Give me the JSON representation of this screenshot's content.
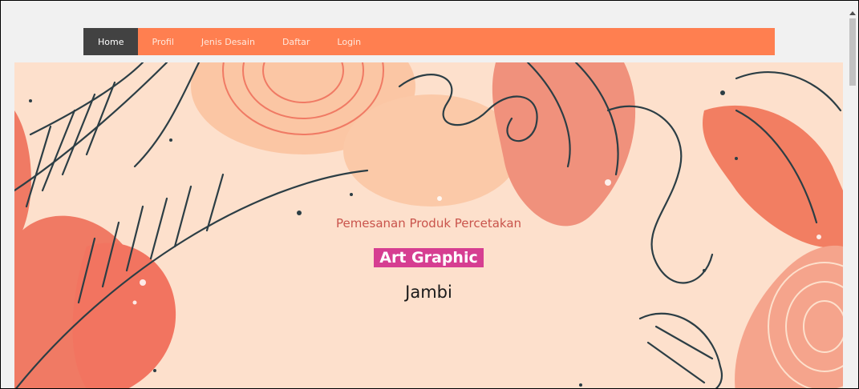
{
  "nav": {
    "items": [
      {
        "label": "Home",
        "active": true
      },
      {
        "label": "Profil"
      },
      {
        "label": "Jenis Desain"
      },
      {
        "label": "Daftar"
      },
      {
        "label": "Login"
      }
    ]
  },
  "hero": {
    "subtitle": "Pemesanan Produk Percetakan",
    "brand": "Art Graphic",
    "city": "Jambi"
  },
  "colors": {
    "nav_bg": "#ff7f50",
    "nav_active": "#424242",
    "hero_bg": "#fde0cc",
    "accent_leaf": "#f07a64",
    "brand_badge": "#d63e91",
    "subtitle_text": "#c9544c"
  }
}
